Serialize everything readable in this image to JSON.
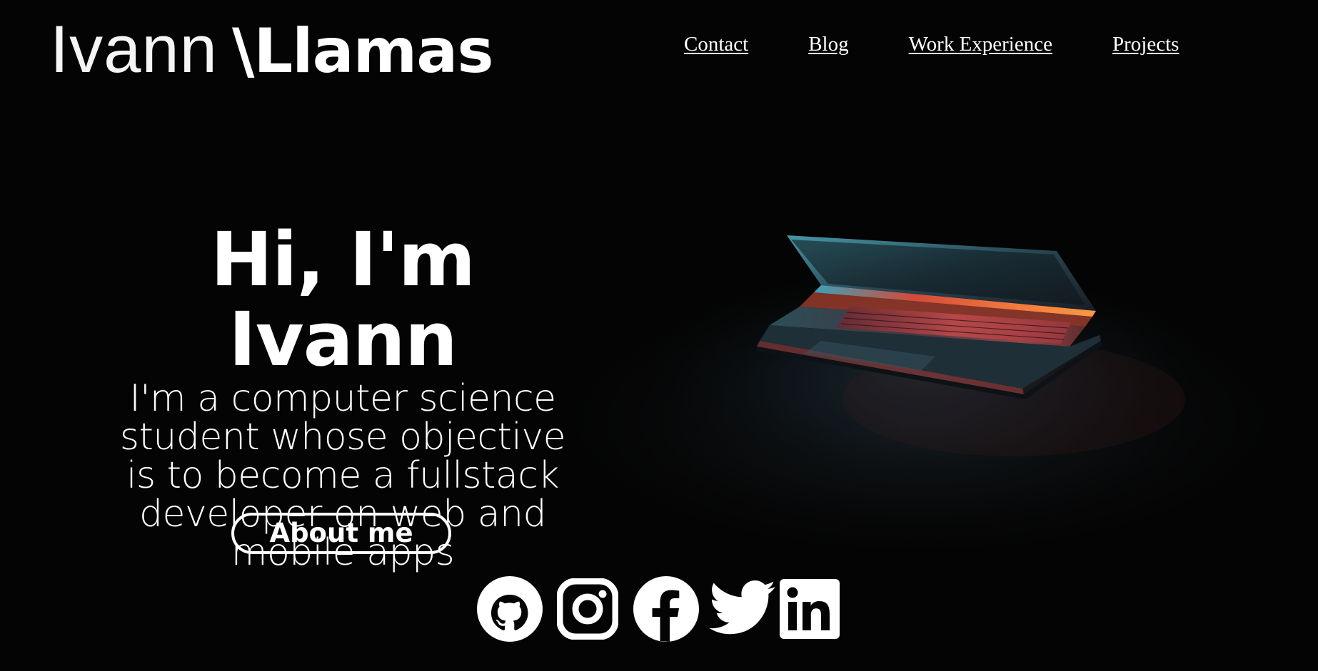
{
  "header": {
    "logo": {
      "first": "Ivann",
      "slash": "\\",
      "last": "Llamas"
    },
    "nav": [
      {
        "label": "Contact"
      },
      {
        "label": "Blog"
      },
      {
        "label": "Work Experience"
      },
      {
        "label": "Projects"
      }
    ]
  },
  "hero": {
    "title": "Hi, I'm Ivann",
    "subtitle": "I'm a computer science student whose objective is to become a fullstack developer on web and mobile apps",
    "button_label": "About me",
    "background_image": "laptop-in-dark-image"
  },
  "socials": [
    {
      "icon": "github-icon"
    },
    {
      "icon": "instagram-icon"
    },
    {
      "icon": "facebook-icon"
    },
    {
      "icon": "twitter-icon"
    },
    {
      "icon": "linkedin-icon"
    }
  ],
  "colors": {
    "background": "#040404",
    "text": "#ffffff"
  }
}
